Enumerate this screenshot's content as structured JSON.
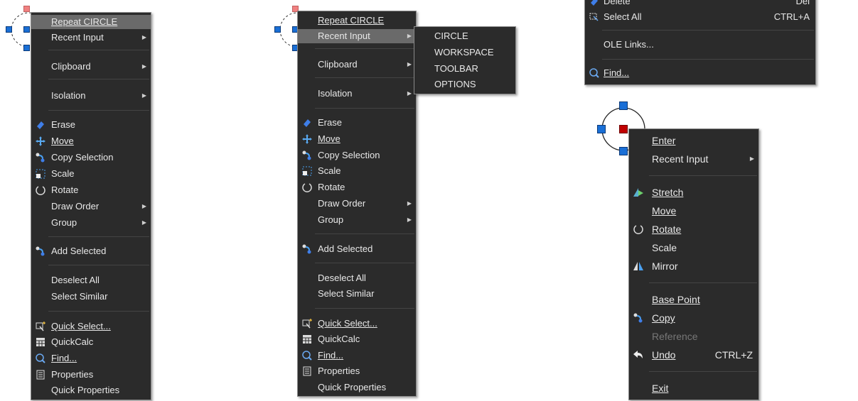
{
  "menu1": {
    "items": [
      "Repeat CIRCLE",
      "Recent Input",
      "Clipboard",
      "Isolation",
      "Erase",
      "Move",
      "Copy Selection",
      "Scale",
      "Rotate",
      "Draw Order",
      "Group",
      "Add Selected",
      "Deselect All",
      "Select Similar",
      "Quick Select...",
      "QuickCalc",
      "Find...",
      "Properties",
      "Quick Properties"
    ]
  },
  "menu2": {
    "items": [
      "Repeat CIRCLE",
      "Recent Input",
      "Clipboard",
      "Isolation",
      "Erase",
      "Move",
      "Copy Selection",
      "Scale",
      "Rotate",
      "Draw Order",
      "Group",
      "Add Selected",
      "Deselect All",
      "Select Similar",
      "Quick Select...",
      "QuickCalc",
      "Find...",
      "Properties",
      "Quick Properties"
    ],
    "submenu": [
      "CIRCLE",
      "WORKSPACE",
      "TOOLBAR",
      "OPTIONS"
    ]
  },
  "menu3": {
    "items": [
      "Delete",
      "Select All",
      "OLE Links...",
      "Find..."
    ],
    "shortcuts": [
      "Del",
      "CTRL+A"
    ]
  },
  "menu4": {
    "items": [
      "Enter",
      "Recent Input",
      "Stretch",
      "Move",
      "Rotate",
      "Scale",
      "Mirror",
      "Base Point",
      "Copy",
      "Reference",
      "Undo",
      "Exit"
    ],
    "undo_shortcut": "CTRL+Z"
  },
  "colors": {
    "menu_bg": "#2b2b2b",
    "highlight": "#6a6a6a",
    "grip": "#1a6fd6",
    "base_grip": "#c00000"
  }
}
